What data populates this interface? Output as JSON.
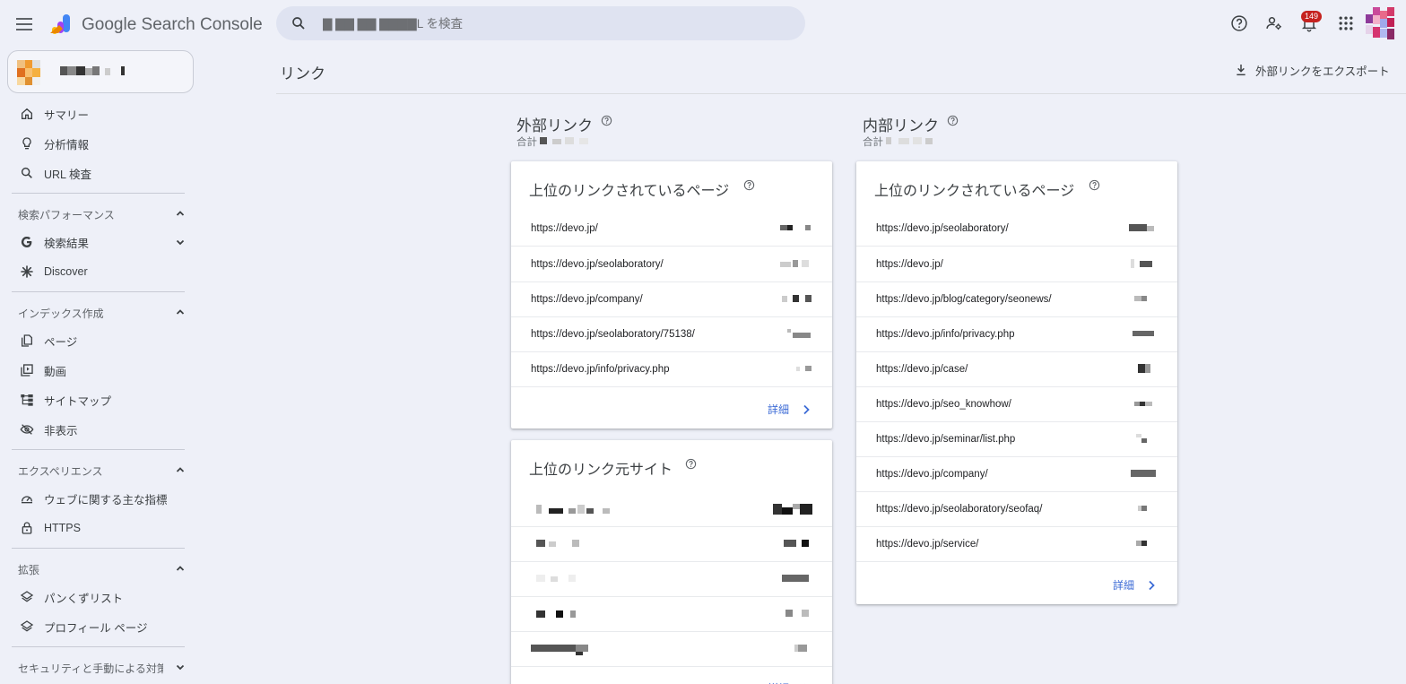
{
  "app": {
    "brand": "Google Search Console",
    "notifications_count": "149"
  },
  "search": {
    "placeholder": "▇ ▇▇ ▇▇ ▇▇▇▇L を検査"
  },
  "sidebar": {
    "property_name": "",
    "items": [
      {
        "label": "サマリー",
        "icon": "home-icon"
      },
      {
        "label": "分析情報",
        "icon": "lightbulb-icon"
      },
      {
        "label": "URL 検査",
        "icon": "search-icon"
      }
    ],
    "sections": [
      {
        "label": "検索パフォーマンス",
        "items": [
          {
            "label": "検索結果",
            "icon": "google-g-icon"
          },
          {
            "label": "Discover",
            "icon": "asterisk-icon"
          }
        ]
      },
      {
        "label": "インデックス作成",
        "items": [
          {
            "label": "ページ",
            "icon": "pages-icon"
          },
          {
            "label": "動画",
            "icon": "video-icon"
          },
          {
            "label": "サイトマップ",
            "icon": "sitemap-icon"
          },
          {
            "label": "非表示",
            "icon": "hidden-icon"
          }
        ]
      },
      {
        "label": "エクスペリエンス",
        "items": [
          {
            "label": "ウェブに関する主な指標",
            "icon": "gauge-icon"
          },
          {
            "label": "HTTPS",
            "icon": "lock-icon"
          }
        ]
      },
      {
        "label": "拡張",
        "items": [
          {
            "label": "パンくずリスト",
            "icon": "layers-icon"
          },
          {
            "label": "プロフィール ページ",
            "icon": "layers-icon"
          }
        ]
      },
      {
        "label": "セキュリティと手動による対策",
        "items": []
      }
    ]
  },
  "main": {
    "title": "リンク",
    "export_label": "外部リンクをエクスポート",
    "external": {
      "title": "外部リンク",
      "total_label": "合計",
      "top_pages": {
        "title": "上位のリンクされているページ",
        "rows": [
          "https://devo.jp/",
          "https://devo.jp/seolaboratory/",
          "https://devo.jp/company/",
          "https://devo.jp/seolaboratory/75138/",
          "https://devo.jp/info/privacy.php"
        ],
        "details": "詳細"
      },
      "top_sites": {
        "title": "上位のリンク元サイト",
        "details": "詳細"
      }
    },
    "internal": {
      "title": "内部リンク",
      "total_label": "合計",
      "top_pages": {
        "title": "上位のリンクされているページ",
        "rows": [
          "https://devo.jp/seolaboratory/",
          "https://devo.jp/",
          "https://devo.jp/blog/category/seonews/",
          "https://devo.jp/info/privacy.php",
          "https://devo.jp/case/",
          "https://devo.jp/seo_knowhow/",
          "https://devo.jp/seminar/list.php",
          "https://devo.jp/company/",
          "https://devo.jp/seolaboratory/seofaq/",
          "https://devo.jp/service/"
        ],
        "details": "詳細"
      }
    }
  }
}
